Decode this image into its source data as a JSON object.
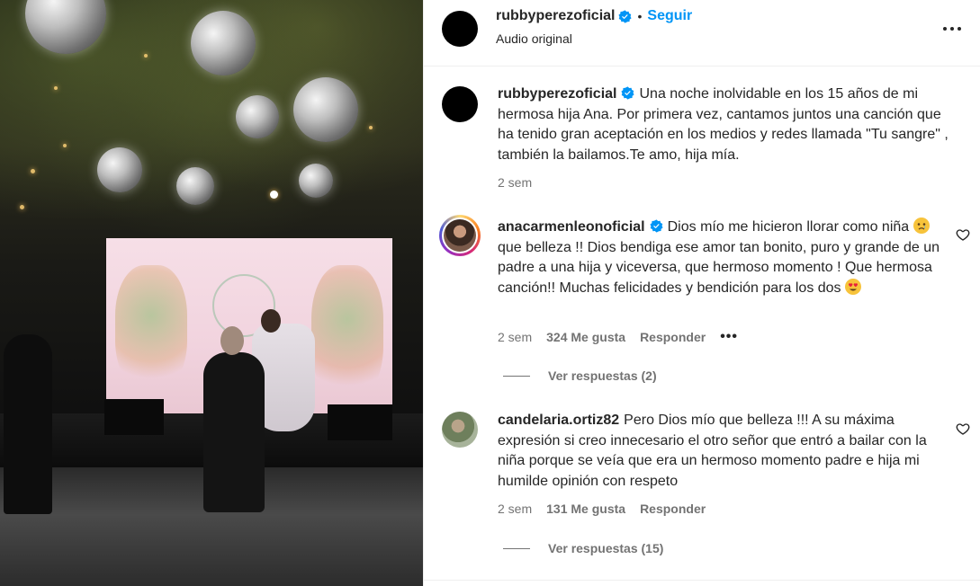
{
  "post": {
    "author": "rubbyperezoficial",
    "follow_label": "Seguir",
    "separator": "•",
    "audio": "Audio original"
  },
  "caption": {
    "author": "rubbyperezoficial",
    "text": "Una noche inolvidable en los 15 años de mi hermosa hija Ana. Por primera vez, cantamos juntos una canción que ha tenido gran aceptación en los medios y redes llamada \"Tu sangre\" , también la bailamos.Te amo, hija mía.",
    "time": "2 sem"
  },
  "comments": [
    {
      "author": "anacarmenleonoficial",
      "text_before_emoji1": "Dios mío me hicieron llorar como niña",
      "text_after_emoji1": " que belleza !! Dios bendiga ese amor tan bonito, puro y grande de un padre a una hija y viceversa, que hermoso momento ! Que hermosa canción!! Muchas felicidades y bendición para los dos",
      "emoji1": "crying-face",
      "emoji2": "heart-eyes-face",
      "time": "2 sem",
      "likes": "324 Me gusta",
      "reply_label": "Responder",
      "view_replies": "Ver respuestas (2)"
    },
    {
      "author": "candelaria.ortiz82",
      "text": "Pero Dios mío que belleza !!! A su máxima expresión si creo innecesario el otro señor que entró a bailar con la niña porque se veía que era un hermoso momento padre e hija mi humilde opinión con respeto",
      "time": "2 sem",
      "likes": "131 Me gusta",
      "reply_label": "Responder",
      "view_replies": "Ver respuestas (15)"
    }
  ],
  "colors": {
    "link_blue": "#0095f6",
    "verified_blue": "#0095f6",
    "secondary_text": "#737373",
    "primary_text": "#262626"
  }
}
